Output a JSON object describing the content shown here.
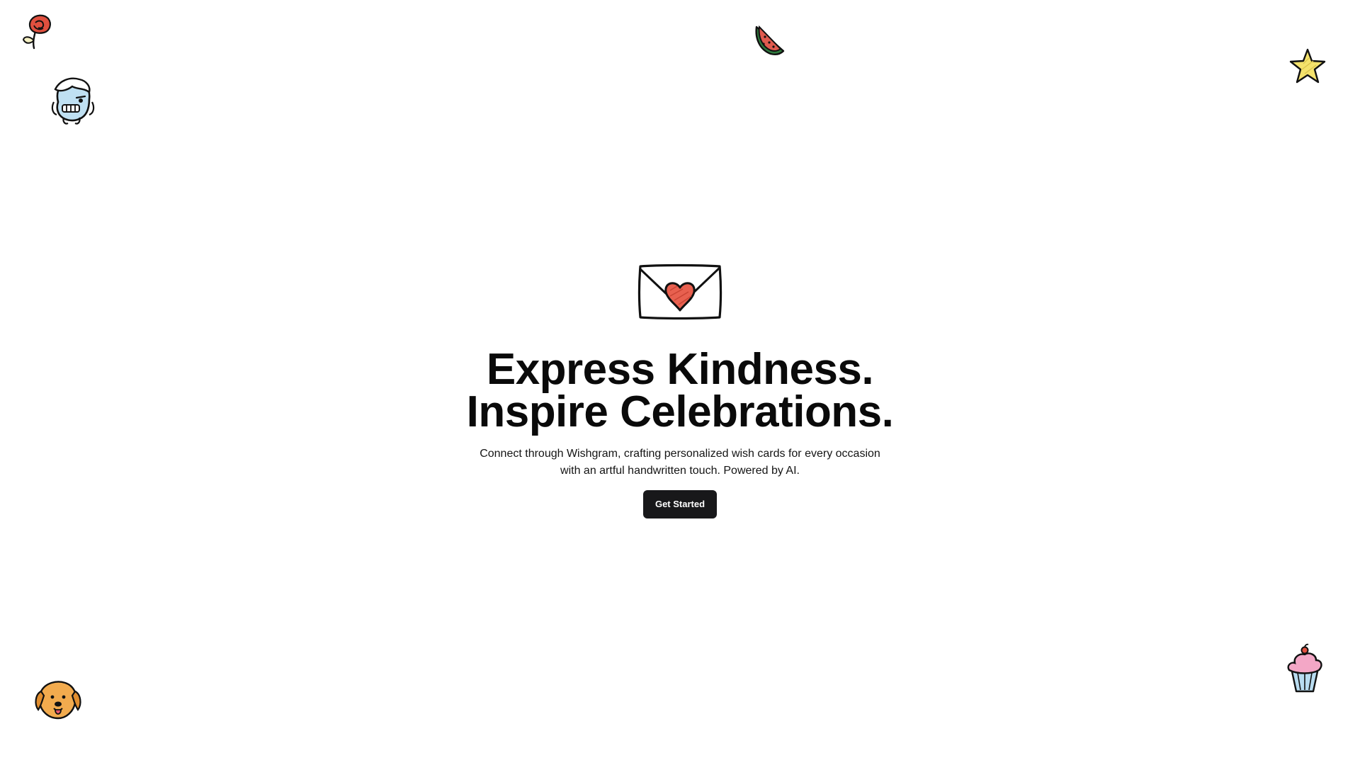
{
  "hero": {
    "headline_line1": "Express Kindness.",
    "headline_line2": "Inspire Celebrations.",
    "subtitle_line1": "Connect through Wishgram, crafting personalized wish cards for every occasion",
    "subtitle_line2": "with an artful handwritten touch. Powered by AI.",
    "cta_label": "Get Started"
  },
  "icons": {
    "hero": "envelope-heart-icon",
    "decorations": [
      "rose-icon",
      "monster-icon",
      "watermelon-icon",
      "star-icon",
      "dog-icon",
      "cupcake-icon"
    ]
  },
  "colors": {
    "background": "#ffffff",
    "text": "#0a0a0a",
    "button": "#18181a",
    "button_text": "#ffffff",
    "heart": "#e8604f",
    "star": "#f3e06a",
    "dog": "#f0a84a",
    "monster": "#b9dcf0",
    "cupcake_frosting": "#f2a6c4",
    "cupcake_base": "#b9dcf0"
  }
}
